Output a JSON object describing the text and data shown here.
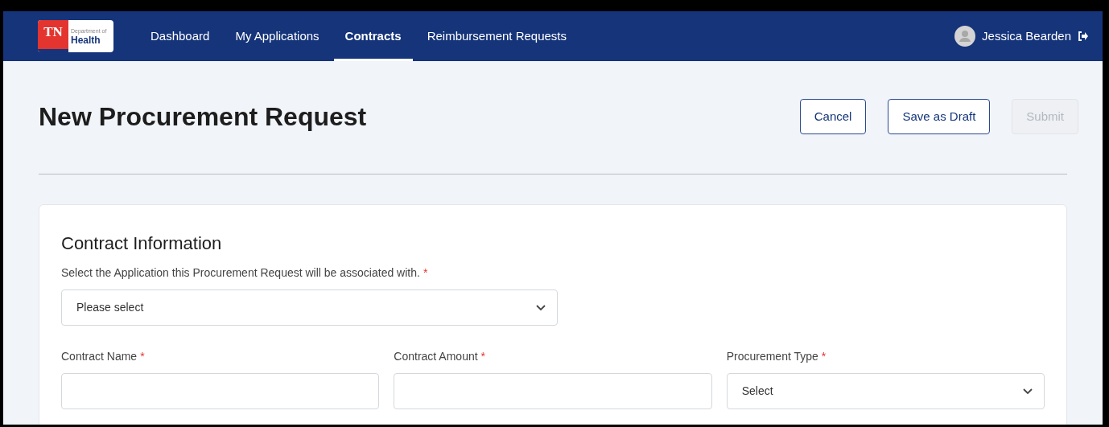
{
  "logo": {
    "mark": "TN",
    "line1": "Department of",
    "line2": "Health"
  },
  "nav": [
    {
      "label": "Dashboard",
      "selected": false
    },
    {
      "label": "My Applications",
      "selected": false
    },
    {
      "label": "Contracts",
      "selected": true
    },
    {
      "label": "Reimbursement Requests",
      "selected": false
    }
  ],
  "user": {
    "name": "Jessica Bearden"
  },
  "page_title": "New Procurement Request",
  "buttons": [
    {
      "label": "Cancel",
      "disabled": false
    },
    {
      "label": "Save as Draft",
      "disabled": false
    },
    {
      "label": "Submit",
      "disabled": true
    }
  ],
  "section": {
    "title": "Contract Information",
    "application_field": {
      "label": "Select the Application this Procurement Request will be associated with.",
      "required_mark": "*",
      "kind": "select",
      "value": "Please select"
    },
    "fields": [
      {
        "label": "Contract Name",
        "required_mark": "*",
        "kind": "text"
      },
      {
        "label": "Contract Amount",
        "required_mark": "*",
        "kind": "text"
      },
      {
        "label": "Procurement Type",
        "required_mark": "*",
        "kind": "select",
        "value": "Select"
      }
    ]
  }
}
